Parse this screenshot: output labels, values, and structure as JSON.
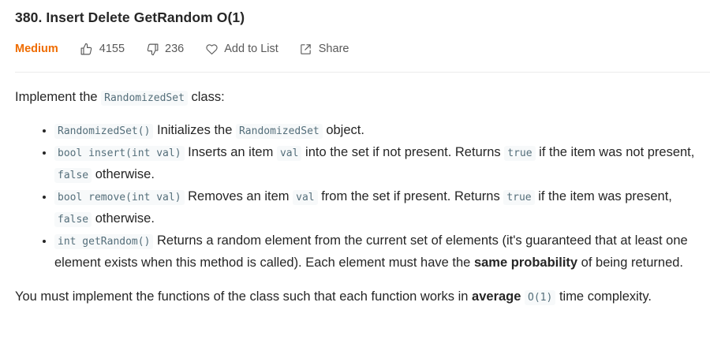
{
  "header": {
    "title": "380. Insert Delete GetRandom O(1)"
  },
  "meta": {
    "difficulty": "Medium",
    "likes": "4155",
    "dislikes": "236",
    "add_to_list": "Add to List",
    "share": "Share",
    "colors": {
      "difficulty": "#ef6c00",
      "text": "#262626",
      "muted": "#595959",
      "code_bg": "#f7f9fa",
      "code_fg": "#546e7a"
    }
  },
  "description": {
    "intro_prefix": "Implement the",
    "intro_code": "RandomizedSet",
    "intro_suffix": "class:",
    "items": [
      {
        "code": "RandomizedSet()",
        "text_before": "Initializes the",
        "code2": "RandomizedSet",
        "text_after": "object."
      },
      {
        "code": "bool insert(int val)",
        "text_before": "Inserts an item",
        "code2": "val",
        "text_mid": "into the set if not present. Returns",
        "code3": "true",
        "text_mid2": "if the item was not present,",
        "code4": "false",
        "text_after": "otherwise."
      },
      {
        "code": "bool remove(int val)",
        "text_before": "Removes an item",
        "code2": "val",
        "text_mid": "from the set if present. Returns",
        "code3": "true",
        "text_mid2": "if the item was present,",
        "code4": "false",
        "text_after": "otherwise."
      },
      {
        "code": "int getRandom()",
        "text_before": "Returns a random element from the current set of elements (it's guaranteed that at least one element exists when this method is called). Each element must have the",
        "bold": "same probability",
        "text_after": "of being returned."
      }
    ],
    "final_prefix": "You must implement the functions of the class such that each function works in",
    "final_bold": "average",
    "final_code": "O(1)",
    "final_suffix": "time complexity."
  }
}
